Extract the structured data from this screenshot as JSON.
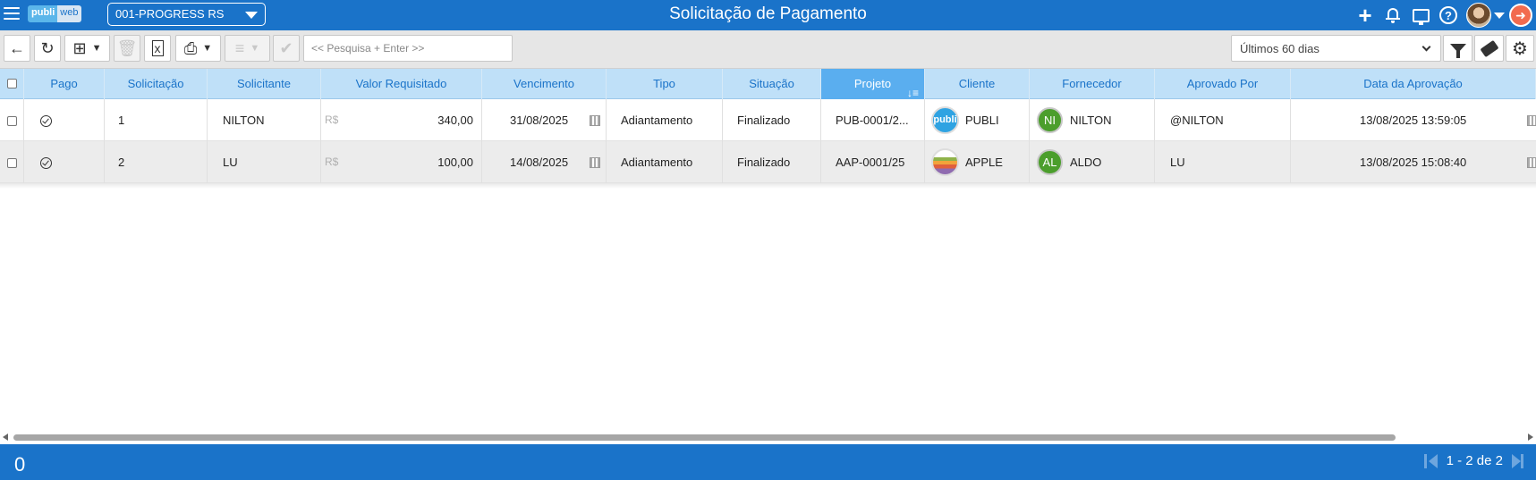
{
  "header": {
    "logo_part1": "publi",
    "logo_part2": "web",
    "company": "001-PROGRESS RS",
    "title": "Solicitação de Pagamento"
  },
  "toolbar": {
    "search_placeholder": "<< Pesquisa + Enter >>",
    "period": "Últimos 60 dias"
  },
  "columns": [
    "Pago",
    "Solicitação",
    "Solicitante",
    "Valor Requisitado",
    "Vencimento",
    "Tipo",
    "Situação",
    "Projeto",
    "Cliente",
    "Fornecedor",
    "Aprovado Por",
    "Data da Aprovação"
  ],
  "currency": "R$",
  "rows": [
    {
      "solicitacao": "1",
      "solicitante": "NILTON",
      "valor": "340,00",
      "vencimento": "31/08/2025",
      "tipo": "Adiantamento",
      "situacao": "Finalizado",
      "projeto": "PUB-0001/2...",
      "cliente_logo": "publi",
      "cliente": "PUBLI",
      "fornecedor_initials": "NI",
      "fornecedor": "NILTON",
      "aprovado_por": "@NILTON",
      "data_aprovacao": "13/08/2025 13:59:05"
    },
    {
      "solicitacao": "2",
      "solicitante": "LU",
      "valor": "100,00",
      "vencimento": "14/08/2025",
      "tipo": "Adiantamento",
      "situacao": "Finalizado",
      "projeto": "AAP-0001/25",
      "cliente_logo": "",
      "cliente": "APPLE",
      "fornecedor_initials": "AL",
      "fornecedor": "ALDO",
      "aprovado_por": "LU",
      "data_aprovacao": "13/08/2025 15:08:40"
    }
  ],
  "footer": {
    "count": "0",
    "pagination": "1 - 2 de 2"
  }
}
